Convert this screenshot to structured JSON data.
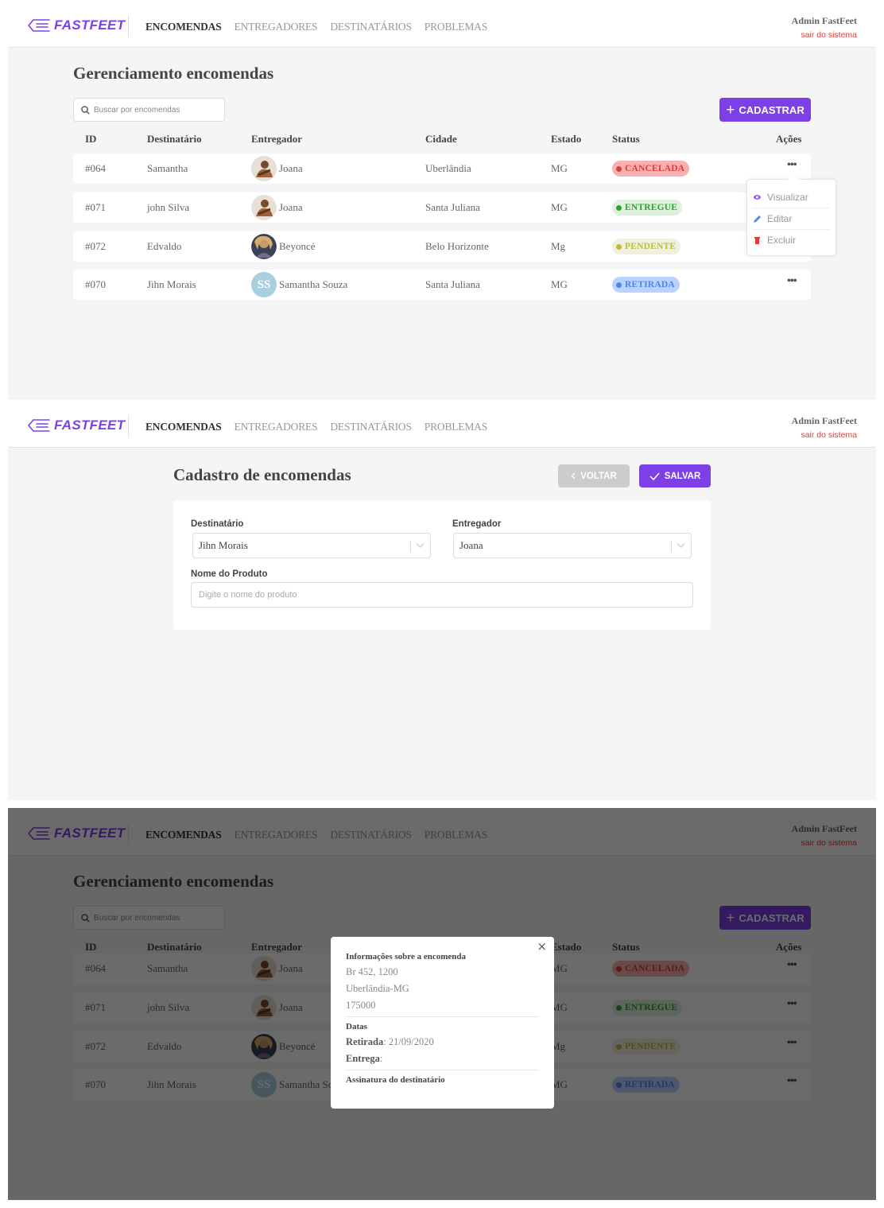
{
  "header": {
    "logo": "FASTFEET",
    "nav": [
      "ENCOMENDAS",
      "ENTREGADORES",
      "DESTINATÁRIOS",
      "PROBLEMAS"
    ],
    "user_name": "Admin FastFeet",
    "logout": "sair do sistema"
  },
  "list": {
    "title": "Gerenciamento encomendas",
    "search_placeholder": "Buscar por encomendas",
    "register_button": "CADASTRAR",
    "columns": [
      "ID",
      "Destinatário",
      "Entregador",
      "Cidade",
      "Estado",
      "Status",
      "Ações"
    ],
    "rows": [
      {
        "id": "#064",
        "recipient": "Samantha",
        "deliveryman": "Joana",
        "city": "Uberlândia",
        "state": "MG",
        "status": "CANCELADA"
      },
      {
        "id": "#071",
        "recipient": "john Silva",
        "deliveryman": "Joana",
        "city": "Santa Juliana",
        "state": "MG",
        "status": "ENTREGUE"
      },
      {
        "id": "#072",
        "recipient": "Edvaldo",
        "deliveryman": "Beyoncé",
        "city": "Belo Horizonte",
        "state": "Mg",
        "status": "PENDENTE"
      },
      {
        "id": "#070",
        "recipient": "Jihn Morais",
        "deliveryman": "Samantha Souza",
        "deliveryman_initials": "SS",
        "city": "Santa Juliana",
        "state": "MG",
        "status": "RETIRADA"
      }
    ],
    "actions_icon": "•••",
    "menu": [
      "Visualizar",
      "Editar",
      "Excluir"
    ]
  },
  "status_colors": {
    "CANCELADA": {
      "bg": "#fab0b0",
      "fg": "#de3b3b"
    },
    "ENTREGUE": {
      "bg": "#dff0df",
      "fg": "#2ca42b"
    },
    "PENDENTE": {
      "bg": "#f0f0df",
      "fg": "#c1bc35"
    },
    "RETIRADA": {
      "bg": "#bad2ff",
      "fg": "#4d85ee"
    }
  },
  "form": {
    "title": "Cadastro de encomendas",
    "back_button": "VOLTAR",
    "save_button": "SALVAR",
    "recipient_label": "Destinatário",
    "recipient_value": "Jihn Morais",
    "deliveryman_label": "Entregador",
    "deliveryman_value": "Joana",
    "product_label": "Nome do Produto",
    "product_placeholder": "Digite o nome do produto"
  },
  "modal": {
    "close": "×",
    "info_title": "Informações sobre a encomenda",
    "address": "Br 452, 1200",
    "city_state": "Uberlândia-MG",
    "zip": "175000",
    "dates_title": "Datas",
    "withdrawal_label": "Retirada",
    "withdrawal_value": ": 21/09/2020",
    "delivery_label": "Entrega",
    "delivery_value": ":",
    "signature_title": "Assinatura do destinatário"
  },
  "colors": {
    "accent": "#7d40e7",
    "danger": "#de3b3b"
  }
}
